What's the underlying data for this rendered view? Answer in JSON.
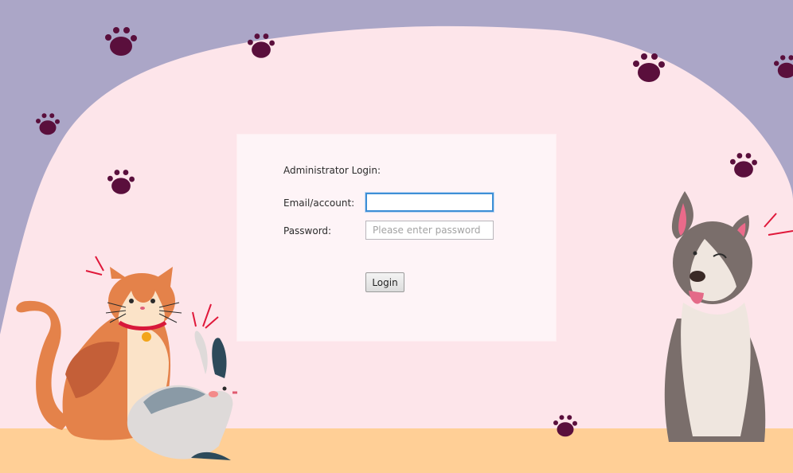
{
  "login": {
    "title": "Administrator Login:",
    "email_label": "Email/account:",
    "email_value": "",
    "email_placeholder": "",
    "password_label": "Password:",
    "password_placeholder": "Please enter password",
    "login_button": "Login"
  },
  "theme": {
    "background_top": "#aba6c7",
    "blob_pink": "#fde5ea",
    "floor": "#ffcf96",
    "paw_color": "#5a0f3c",
    "focus_border": "#3e8fd6"
  },
  "decorations": {
    "icons": [
      "paw-print-icon",
      "cat-illustration",
      "rabbit-illustration",
      "dog-illustration"
    ]
  }
}
